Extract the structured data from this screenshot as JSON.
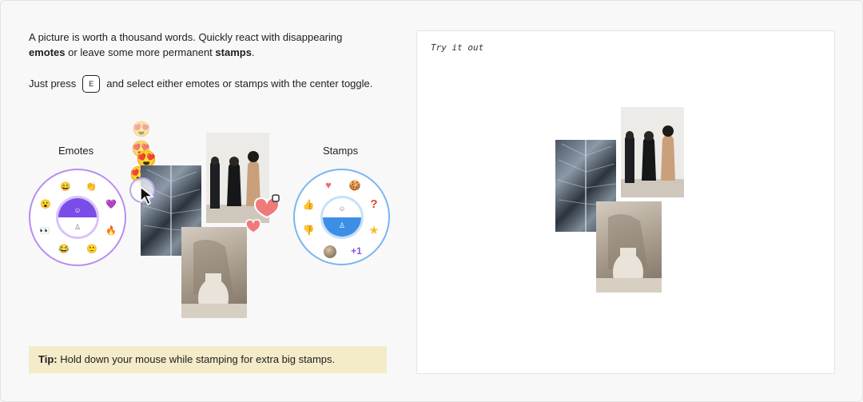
{
  "intro": {
    "line1": "A picture is worth a thousand words. Quickly react with disappearing",
    "emotes_word": "emotes",
    "middle": " or leave some more permanent ",
    "stamps_word": "stamps",
    "end": "."
  },
  "press": {
    "before": "Just press",
    "key": "E",
    "after": "and select either emotes or stamps with the center toggle."
  },
  "emotes_title": "Emotes",
  "stamps_title": "Stamps",
  "stamps_plus": "+1",
  "tip": {
    "label": "Tip:",
    "text": "Hold down your mouse while stamping for extra big stamps."
  },
  "panel": {
    "try_label": "Try it out"
  },
  "colors": {
    "emote_ring": "#b287f0",
    "emote_center": "#7a4ce8",
    "stamp_ring": "#6aaef0",
    "stamp_center": "#3d8fe6",
    "tip_bg": "#f4ebc9"
  }
}
